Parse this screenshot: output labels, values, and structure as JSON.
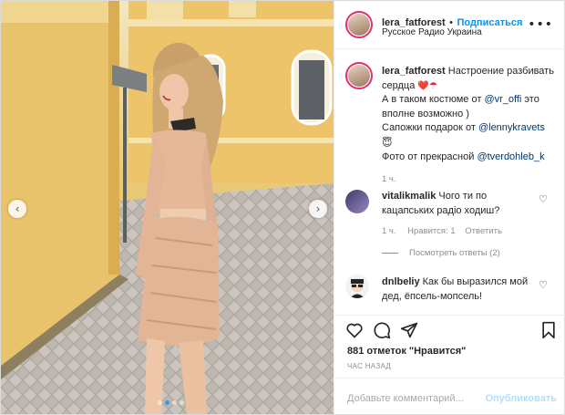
{
  "post": {
    "username": "lera_fatforest",
    "separator": "•",
    "follow_label": "Подписаться",
    "location": "Русское Радио Украина",
    "more_icon": "more-horizontal-icon",
    "carousel": {
      "prev_icon": "chevron-left-icon",
      "next_icon": "chevron-right-icon",
      "slides": 4,
      "active_slide": 2
    }
  },
  "caption": {
    "username": "lera_fatforest",
    "line1_text": "Настроение разбивать",
    "line2_text": "сердца",
    "line2_emoji": "❤️☂",
    "line3_prefix": "А в таком костюме от ",
    "line3_mention": "@vr_offi",
    "line3_suffix": " это",
    "line4_text": "вполне возможно )",
    "line5_prefix": "Сапожки подарок от ",
    "line5_mention": "@lennykravets",
    "line6_emoji": "😇",
    "line7_prefix": "Фото от прекрасной ",
    "line7_mention": "@tverdohleb_k",
    "age": "1 ч."
  },
  "comments": [
    {
      "username": "vitalikmalik",
      "line1": "Чого ти по",
      "line2": "кацапських радіо ходиш?",
      "age": "1 ч.",
      "likes_label": "Нравится: 1",
      "reply_label": "Ответить",
      "view_replies": "Посмотреть ответы (2)"
    },
    {
      "username": "dnlbeliy",
      "line1": "Как бы выразился мой",
      "line2": "дед, ёпсель-мопсель!"
    }
  ],
  "actions": {
    "like_icon": "heart-icon",
    "comment_icon": "comment-icon",
    "share_icon": "share-icon",
    "save_icon": "bookmark-icon"
  },
  "likes_text": "881 отметок \"Нравится\"",
  "timestamp": "ЧАС НАЗАД",
  "add_comment": {
    "placeholder": "Добавьте комментарий...",
    "publish_label": "Опубликовать"
  },
  "colors": {
    "link": "#0095f6",
    "mention": "#00376b",
    "muted": "#8e8e8e",
    "heart": "#e0245e"
  }
}
